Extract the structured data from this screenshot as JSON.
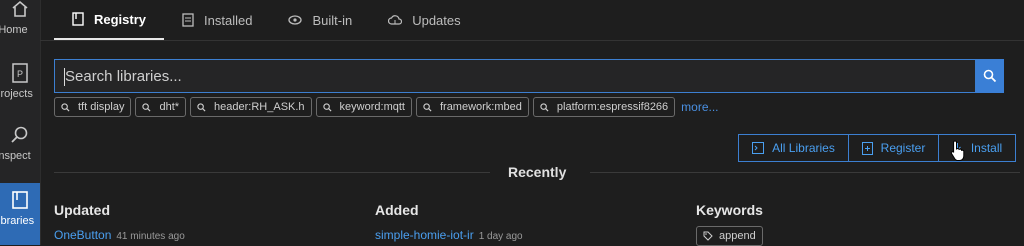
{
  "sidebar": {
    "items": [
      {
        "label": "Home",
        "icon": "home-icon"
      },
      {
        "label": "Projects",
        "icon": "projects-icon"
      },
      {
        "label": "Inspect",
        "icon": "inspect-icon"
      },
      {
        "label": "Libraries",
        "icon": "libraries-icon",
        "active": true
      }
    ]
  },
  "tabs": [
    {
      "label": "Registry",
      "icon": "book-icon",
      "active": true
    },
    {
      "label": "Installed",
      "icon": "list-icon"
    },
    {
      "label": "Built-in",
      "icon": "eye-icon"
    },
    {
      "label": "Updates",
      "icon": "cloud-upload-icon"
    }
  ],
  "search": {
    "placeholder": "Search libraries...",
    "button_icon": "search-icon"
  },
  "chips": [
    "tft display",
    "dht*",
    "header:RH_ASK.h",
    "keyword:mqtt",
    "framework:mbed",
    "platform:espressif8266"
  ],
  "more_label": "more...",
  "actions": {
    "all_libraries": "All Libraries",
    "register": "Register",
    "install": "Install"
  },
  "recently": {
    "title": "Recently",
    "updated_title": "Updated",
    "added_title": "Added",
    "keywords_title": "Keywords",
    "updated": [
      {
        "name": "OneButton",
        "time": "41 minutes ago"
      }
    ],
    "added": [
      {
        "name": "simple-homie-iot-ir",
        "time": "1 day ago"
      }
    ],
    "keywords": [
      "append"
    ]
  },
  "colors": {
    "accent": "#3a7fd6",
    "link": "#4a9ff0",
    "background": "#1e1e1e",
    "active_sidebar": "#2e6bb5"
  }
}
